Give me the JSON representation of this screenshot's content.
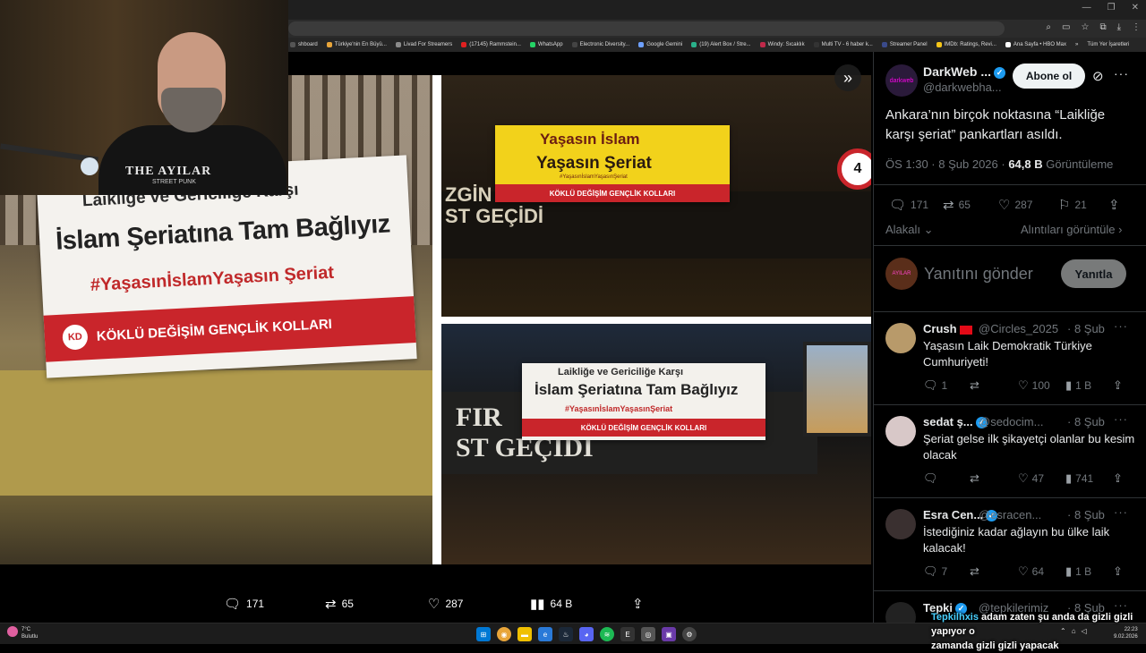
{
  "browser": {
    "bookmarks": [
      {
        "label": "shboard",
        "color": "#555"
      },
      {
        "label": "Türkiye'nin En Büyü...",
        "color": "#e8a53a"
      },
      {
        "label": "Livad For Streamers",
        "color": "#8a8a8a"
      },
      {
        "label": "(17145) Rammstein...",
        "color": "#e02020"
      },
      {
        "label": "WhatsApp",
        "color": "#25d366"
      },
      {
        "label": "Electronic Diversity...",
        "color": "#444"
      },
      {
        "label": "Google Gemini",
        "color": "#6ea0ff"
      },
      {
        "label": "(19) Alert Box / Stre...",
        "color": "#2ab08a"
      },
      {
        "label": "Windy: Sıcaklık",
        "color": "#c0294a"
      },
      {
        "label": "Multi TV - 6 haber k...",
        "color": "#333"
      },
      {
        "label": "Streamer Panel",
        "color": "#3a4a8a"
      },
      {
        "label": "IMDb: Ratings, Revi...",
        "color": "#f5c518"
      },
      {
        "label": "Ana Sayfa • HBO Max",
        "color": "#fff"
      }
    ],
    "bookmarks_more": "»",
    "all_bookmarks": "Tüm Yer İşaretleri"
  },
  "media": {
    "left_banner": {
      "line1": "Laikliğe ve Gericiliğe Karşı",
      "line2": "İslam Şeriatına Tam Bağlıyız",
      "line3": "#YaşasınİslamYaşasın Şeriat",
      "org": "KÖKLÜ DEĞİŞİM GENÇLİK KOLLARI"
    },
    "top_right_banner": {
      "line1": "Yaşasın İslam",
      "line2": "Yaşasın Şeriat",
      "hashtag": "#YaşasınİslamYaşasınŞeriat",
      "org": "KÖKLÜ DEĞİŞİM GENÇLİK KOLLARI"
    },
    "top_right_sign": "ZGİN K\nST GEÇİDİ",
    "speed_sign": "4",
    "bottom_right_banner": {
      "line1": "Laikliğe ve Gericiliğe Karşı",
      "line2": "İslam Şeriatına Tam Bağlıyız",
      "line3": "#YaşasınİslamYaşasınŞeriat",
      "org": "KÖKLÜ DEĞİŞİM GENÇLİK KOLLARI"
    },
    "bottom_right_sign": "FIR\nST GEÇİDİ",
    "org_logo": "KD",
    "expand_icon": "»"
  },
  "webcam": {
    "shirt_text": "THE AYILAR",
    "shirt_sub": "STREET PUNK"
  },
  "media_actions": {
    "replies": "171",
    "reposts": "65",
    "likes": "287",
    "views": "64 B"
  },
  "tweet": {
    "avatar_text": "darkweb",
    "name": "DarkWeb ...",
    "handle": "@darkwebha...",
    "follow": "Abone ol",
    "text": "Ankara’nın birçok noktasına “Laikliğe karşı şeriat” pankartları asıldı.",
    "time": "ÖS 1:30 · 8 Şub 2026 ·",
    "views_count": "64,8 B",
    "views_label": "Görüntüleme",
    "stats": {
      "replies": "171",
      "reposts": "65",
      "likes": "287",
      "bookmarks": "21"
    },
    "sort_label": "Alakalı",
    "quotes_label": "Alıntıları görüntüle",
    "reply_avatar_text": "AYILAR",
    "reply_placeholder": "Yanıtını gönder",
    "reply_button": "Yanıtla"
  },
  "replies": [
    {
      "name": "Crush",
      "handle": "@Circles_2025",
      "date": "· 8 Şub",
      "text": "Yaşasın Laik Demokratik Türkiye Cumhuriyeti!",
      "replies": "1",
      "reposts": "",
      "likes": "100",
      "views": "1 B",
      "avatar_color": "#b89a6a",
      "flag": true
    },
    {
      "name": "sedat ş...",
      "handle": "@sedocim...",
      "date": "· 8 Şub",
      "text": "Şeriat gelse ilk şikayetçi olanlar bu kesim olacak",
      "replies": "",
      "reposts": "",
      "likes": "47",
      "views": "741",
      "avatar_color": "#d8c8c8",
      "flag": false
    },
    {
      "name": "Esra Cen...",
      "handle": "@esracen...",
      "date": "· 8 Şub",
      "text": "İstediğiniz kadar ağlayın bu ülke laik kalacak!",
      "replies": "7",
      "reposts": "",
      "likes": "64",
      "views": "1 B",
      "avatar_color": "#3a3030",
      "flag": false
    },
    {
      "name": "Tepki",
      "handle": "@tepkilerimiz",
      "date": "· 8 Şub",
      "text": "",
      "replies": "",
      "reposts": "",
      "likes": "",
      "views": "",
      "avatar_color": "#222",
      "flag": false
    }
  ],
  "overlay": {
    "highlight": "Tepkilhxis",
    "line1": "adam zaten şu anda da gizli gizli yapıyor o",
    "line2": "zamanda gizli gizli yapacak"
  },
  "taskbar": {
    "temp": "7°C",
    "weather": "Bulutlu",
    "time": "22:23",
    "date": "9.02.2026"
  },
  "colors": {
    "accent": "#1d9bf0",
    "banner_red": "#c9252b",
    "banner_yellow": "#f2d21b"
  }
}
